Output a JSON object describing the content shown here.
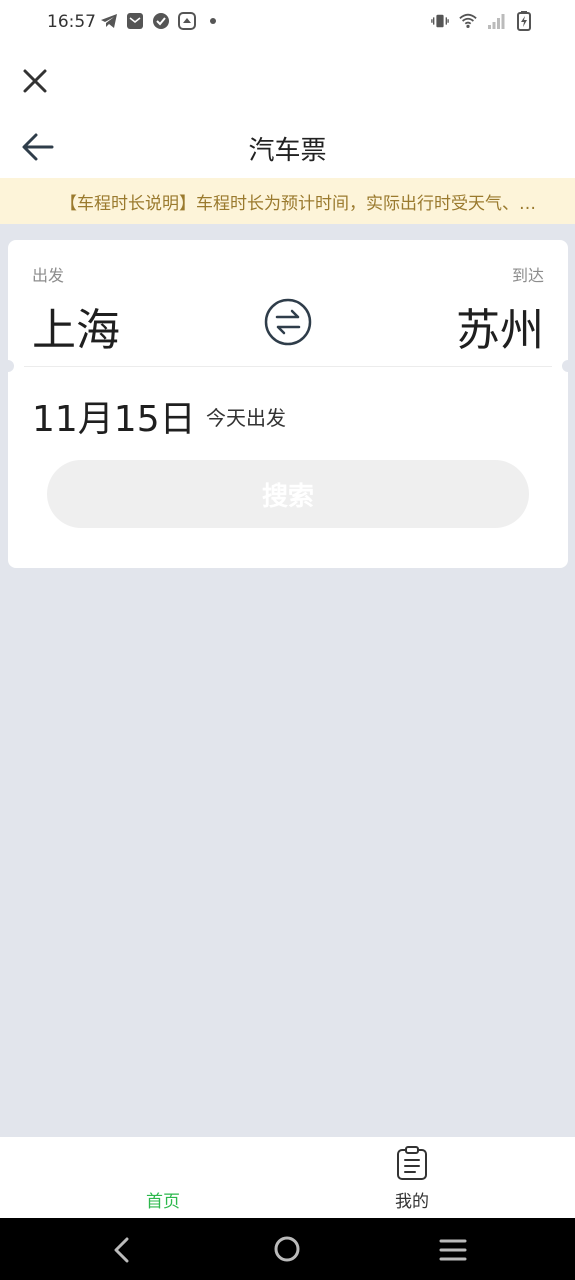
{
  "status": {
    "time": "16:57",
    "left_icons": [
      "telegram-icon",
      "mail-icon",
      "check-circle-icon",
      "app-icon",
      "dot-icon"
    ],
    "right_icons": [
      "vibrate-icon",
      "wifi-icon",
      "signal-icon",
      "battery-charging-icon"
    ]
  },
  "header": {
    "title": "汽车票",
    "close_icon": "close-icon",
    "back_icon": "back-arrow-icon"
  },
  "notice": {
    "text": "【车程时长说明】车程时长为预计时间，实际出行时受天气、…"
  },
  "search_card": {
    "from_label": "出发",
    "to_label": "到达",
    "from_city": "上海",
    "to_city": "苏州",
    "swap_icon": "swap-icon",
    "date": "11月15日",
    "date_note": "今天出发",
    "search_label": "搜索"
  },
  "tabbar": {
    "home_label": "首页",
    "mine_label": "我的",
    "active_color": "#2db84d"
  },
  "colors": {
    "page_bg": "#e2e5ec",
    "notice_bg": "#fdf4d9",
    "notice_text": "#9a7a2e"
  }
}
